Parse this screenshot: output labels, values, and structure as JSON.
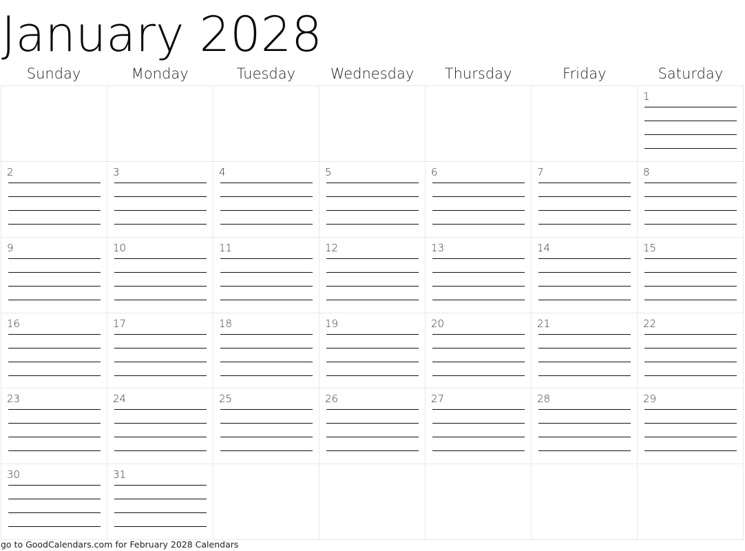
{
  "calendar": {
    "title": "January 2028",
    "weekdays": [
      "Sunday",
      "Monday",
      "Tuesday",
      "Wednesday",
      "Thursday",
      "Friday",
      "Saturday"
    ],
    "weeks": [
      [
        "",
        "",
        "",
        "",
        "",
        "",
        "1"
      ],
      [
        "2",
        "3",
        "4",
        "5",
        "6",
        "7",
        "8"
      ],
      [
        "9",
        "10",
        "11",
        "12",
        "13",
        "14",
        "15"
      ],
      [
        "16",
        "17",
        "18",
        "19",
        "20",
        "21",
        "22"
      ],
      [
        "23",
        "24",
        "25",
        "26",
        "27",
        "28",
        "29"
      ],
      [
        "30",
        "31",
        "",
        "",
        "",
        "",
        ""
      ]
    ],
    "note_lines_per_day": 4
  },
  "footer": {
    "text": "go to GoodCalendars.com for February 2028 Calendars"
  }
}
